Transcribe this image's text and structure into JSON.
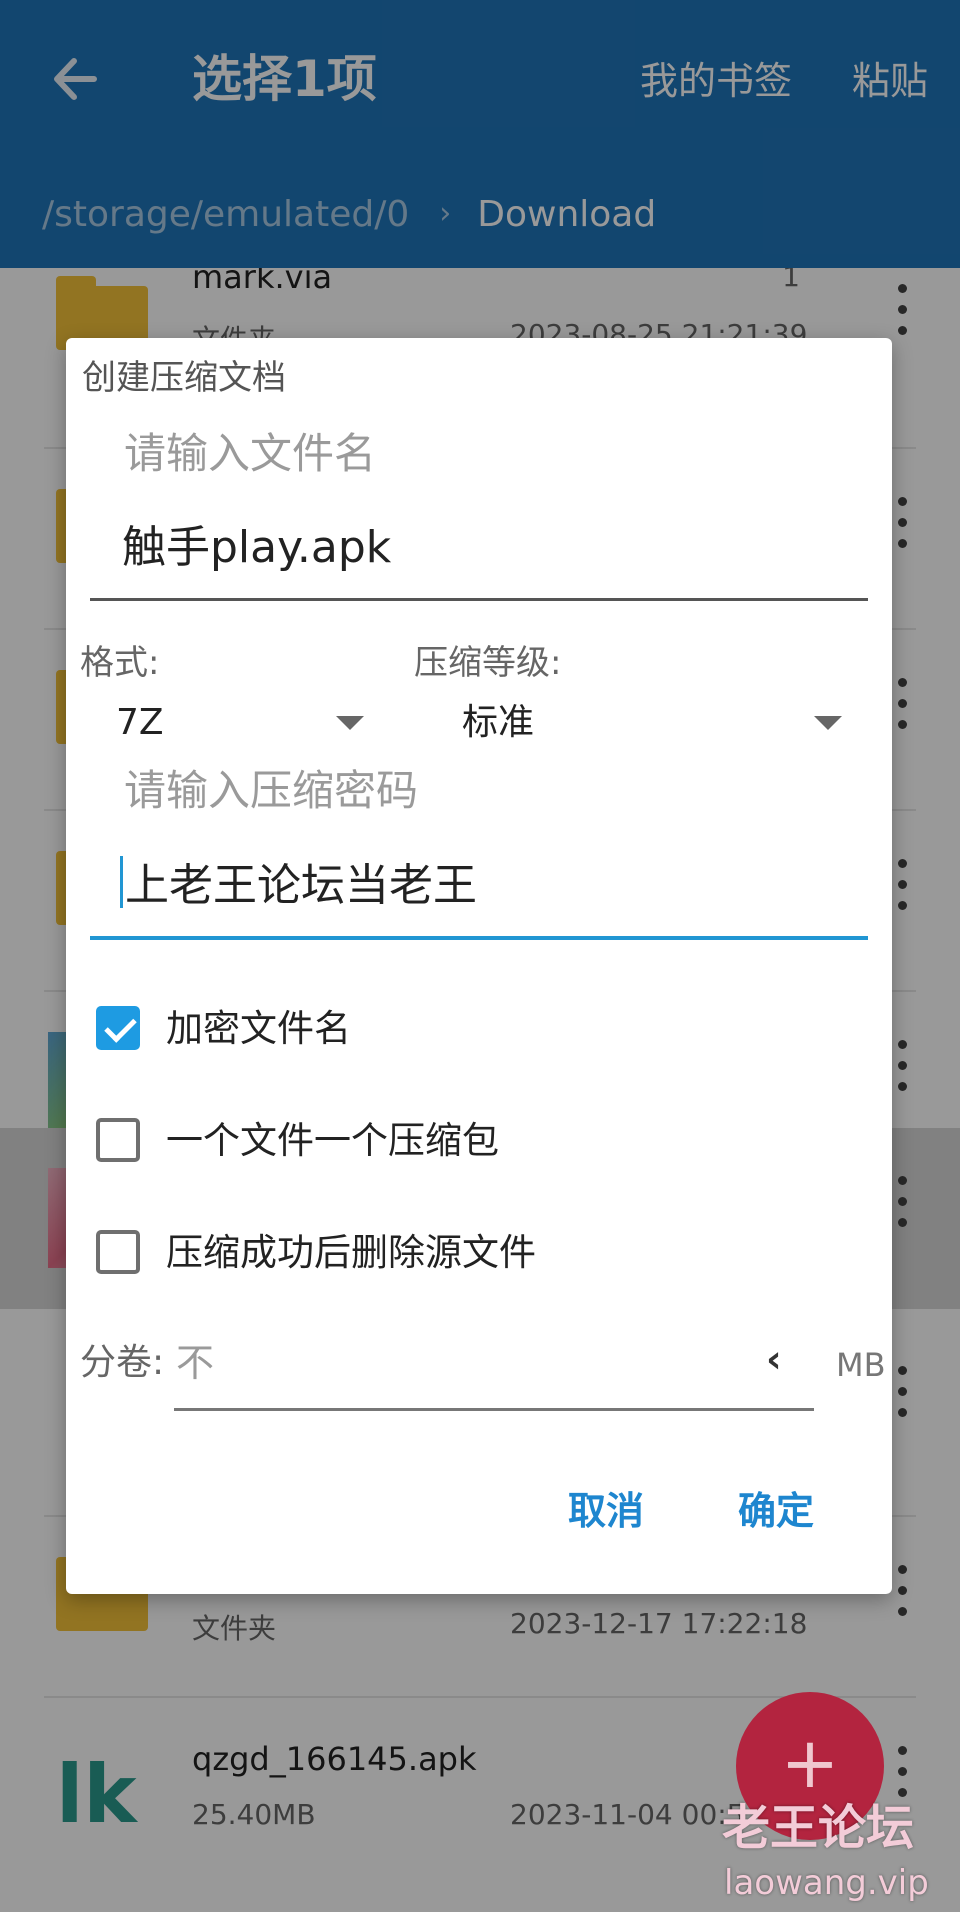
{
  "appbar": {
    "title": "选择1项",
    "bookmark_label": "我的书签",
    "paste_label": "粘贴",
    "breadcrumb_root": "/storage/emulated/0",
    "breadcrumb_current": "Download"
  },
  "files": [
    {
      "name": "mark.via",
      "type": "文件夹",
      "date": "2023-08-25 21:21:39",
      "count": "1"
    },
    {
      "name": "",
      "type": "文件夹",
      "date": "2023-12-17 17:22:18",
      "count": ""
    },
    {
      "name": "qzgd_166145.apk",
      "type": "25.40MB",
      "date": "2023-11-04 00:5",
      "count": ""
    }
  ],
  "dialog": {
    "title": "创建压缩文档",
    "filename_hint": "请输入文件名",
    "filename_value": "触手play.apk",
    "format_label": "格式:",
    "format_value": "7Z",
    "level_label": "压缩等级:",
    "level_value": "标准",
    "password_hint": "请输入压缩密码",
    "password_value": "上老王论坛当老王",
    "checkboxes": [
      {
        "label": "加密文件名",
        "checked": true
      },
      {
        "label": "一个文件一个压缩包",
        "checked": false
      },
      {
        "label": "压缩成功后删除源文件",
        "checked": false
      }
    ],
    "volume_label": "分卷:",
    "volume_value": "不",
    "volume_unit": "MB",
    "cancel_label": "取消",
    "ok_label": "确定"
  },
  "fab_label": "+",
  "watermark": {
    "text": "老王论坛",
    "url": "laowang.vip"
  },
  "colors": {
    "appbar": "#1f75b9",
    "accent": "#1e9be2",
    "fab": "#b3243f",
    "folder": "#f3c23a"
  }
}
